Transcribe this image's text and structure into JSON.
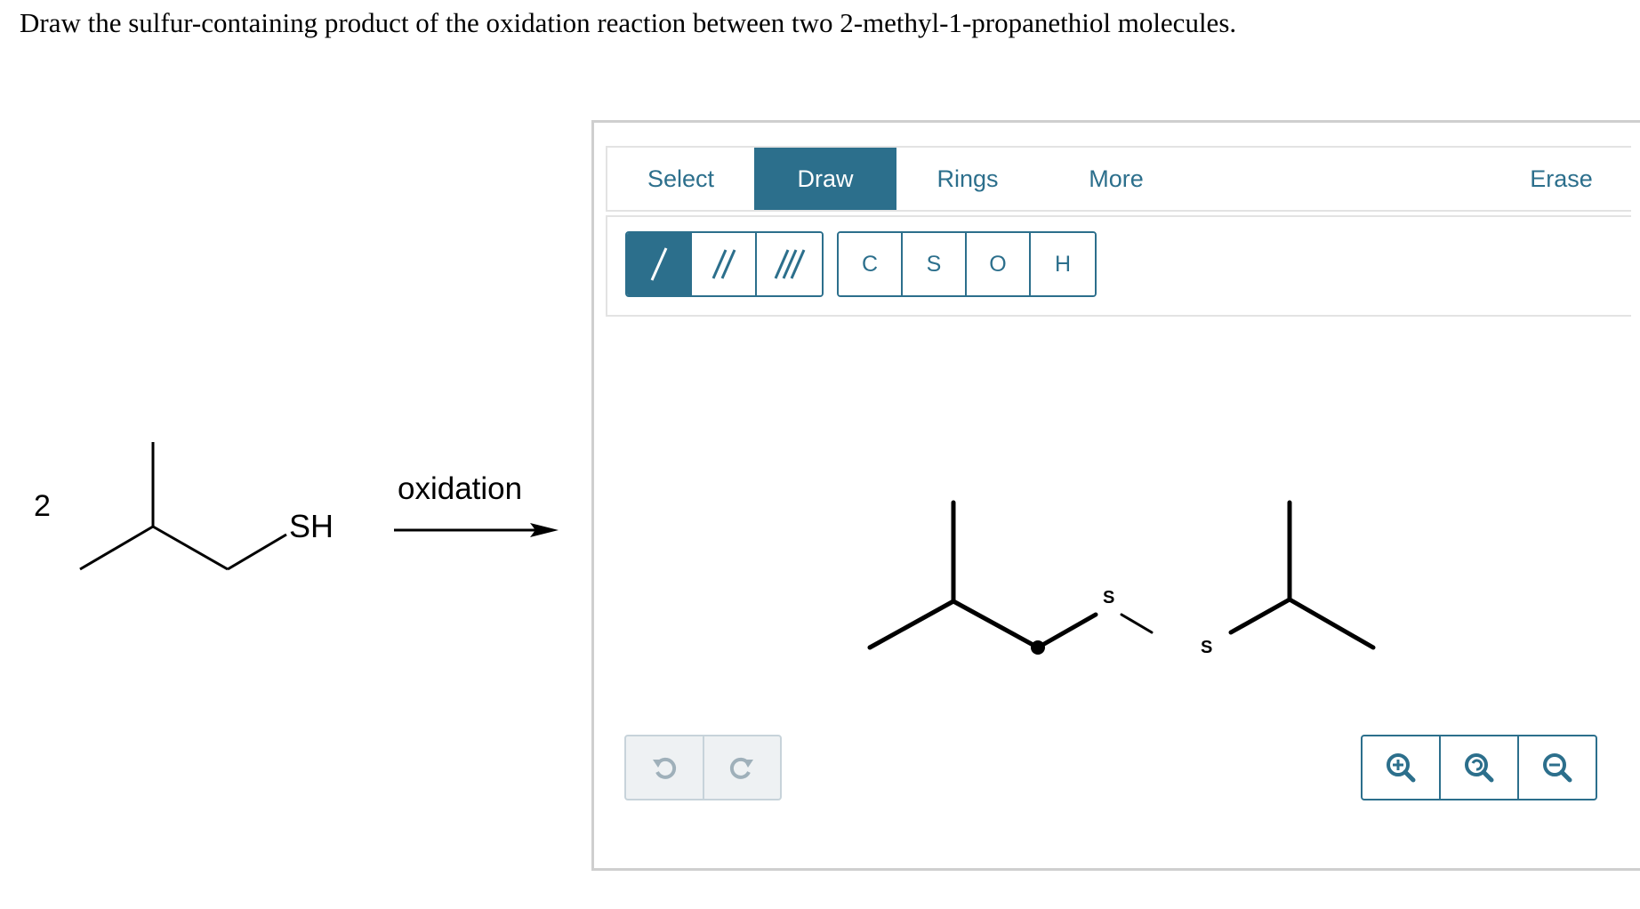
{
  "question": "Draw the sulfur-containing product of the oxidation reaction between two 2-methyl-1-propanethiol molecules.",
  "reaction": {
    "coefficient": "2",
    "thiol_group": "SH",
    "arrow_label": "oxidation"
  },
  "editor": {
    "tabs": [
      {
        "label": "Select",
        "active": false
      },
      {
        "label": "Draw",
        "active": true
      },
      {
        "label": "Rings",
        "active": false
      },
      {
        "label": "More",
        "active": false
      },
      {
        "label": "Erase",
        "active": false
      }
    ],
    "bond_tools": [
      {
        "name": "single-bond",
        "active": true
      },
      {
        "name": "double-bond",
        "active": false
      },
      {
        "name": "triple-bond",
        "active": false
      }
    ],
    "atom_tools": [
      "C",
      "S",
      "O",
      "H"
    ],
    "canvas_atoms": {
      "sulfur_1": "S",
      "sulfur_2": "S"
    },
    "history_icons": [
      "undo-icon",
      "redo-icon"
    ],
    "zoom_icons": [
      "zoom-in-icon",
      "zoom-reset-icon",
      "zoom-out-icon"
    ],
    "colors": {
      "accent": "#2c6f8c",
      "border": "#cfcfcf",
      "disabled": "#c7d3da"
    }
  }
}
